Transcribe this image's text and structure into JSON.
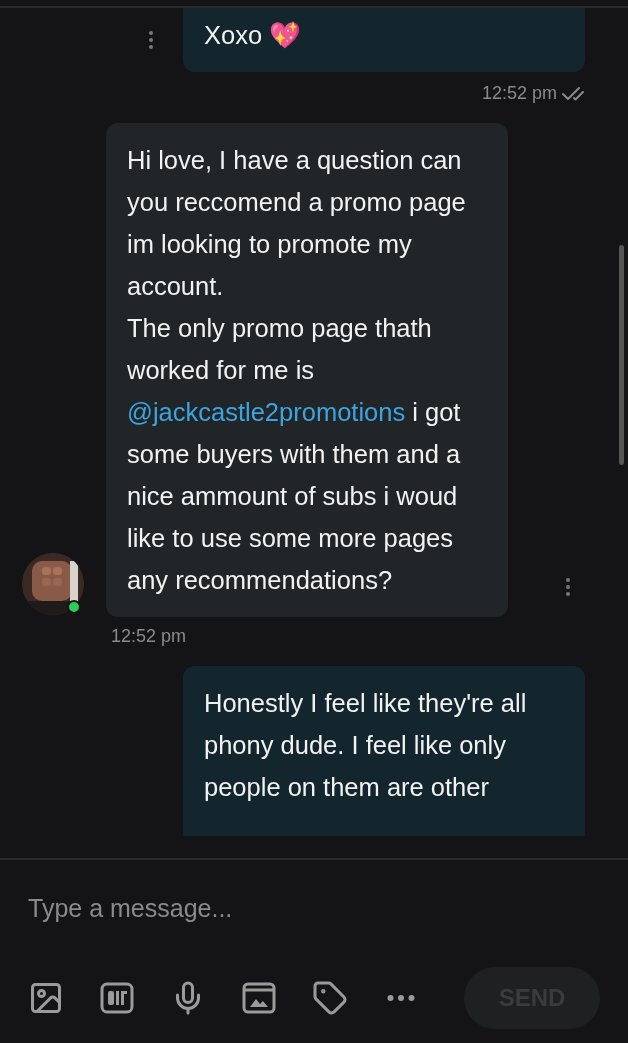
{
  "messages": [
    {
      "kind": "outgoing",
      "parts": [
        {
          "kind": "text",
          "text": "Xoxo 💖"
        }
      ],
      "time": "12:52 pm",
      "read": true,
      "cut_top": true
    },
    {
      "kind": "incoming",
      "parts": [
        {
          "kind": "text",
          "text": "Hi love, I have a question can you reccomend a promo page im looking to promote my account.\nThe only promo page thath worked for me is "
        },
        {
          "kind": "link",
          "text": "@jackcastle2promotions"
        },
        {
          "kind": "text",
          "text": " i got some buyers with them and a nice ammount of subs i woud like to use some more pages any recommendations?"
        }
      ],
      "time": "12:52 pm",
      "online": true
    },
    {
      "kind": "outgoing",
      "parts": [
        {
          "kind": "text",
          "text": "Honestly I feel like they're all phony dude. I feel like only people on them are other"
        }
      ],
      "cut_bottom": true
    }
  ],
  "composer": {
    "placeholder": "Type a message...",
    "send": {
      "label": "SEND",
      "disabled": true
    }
  }
}
